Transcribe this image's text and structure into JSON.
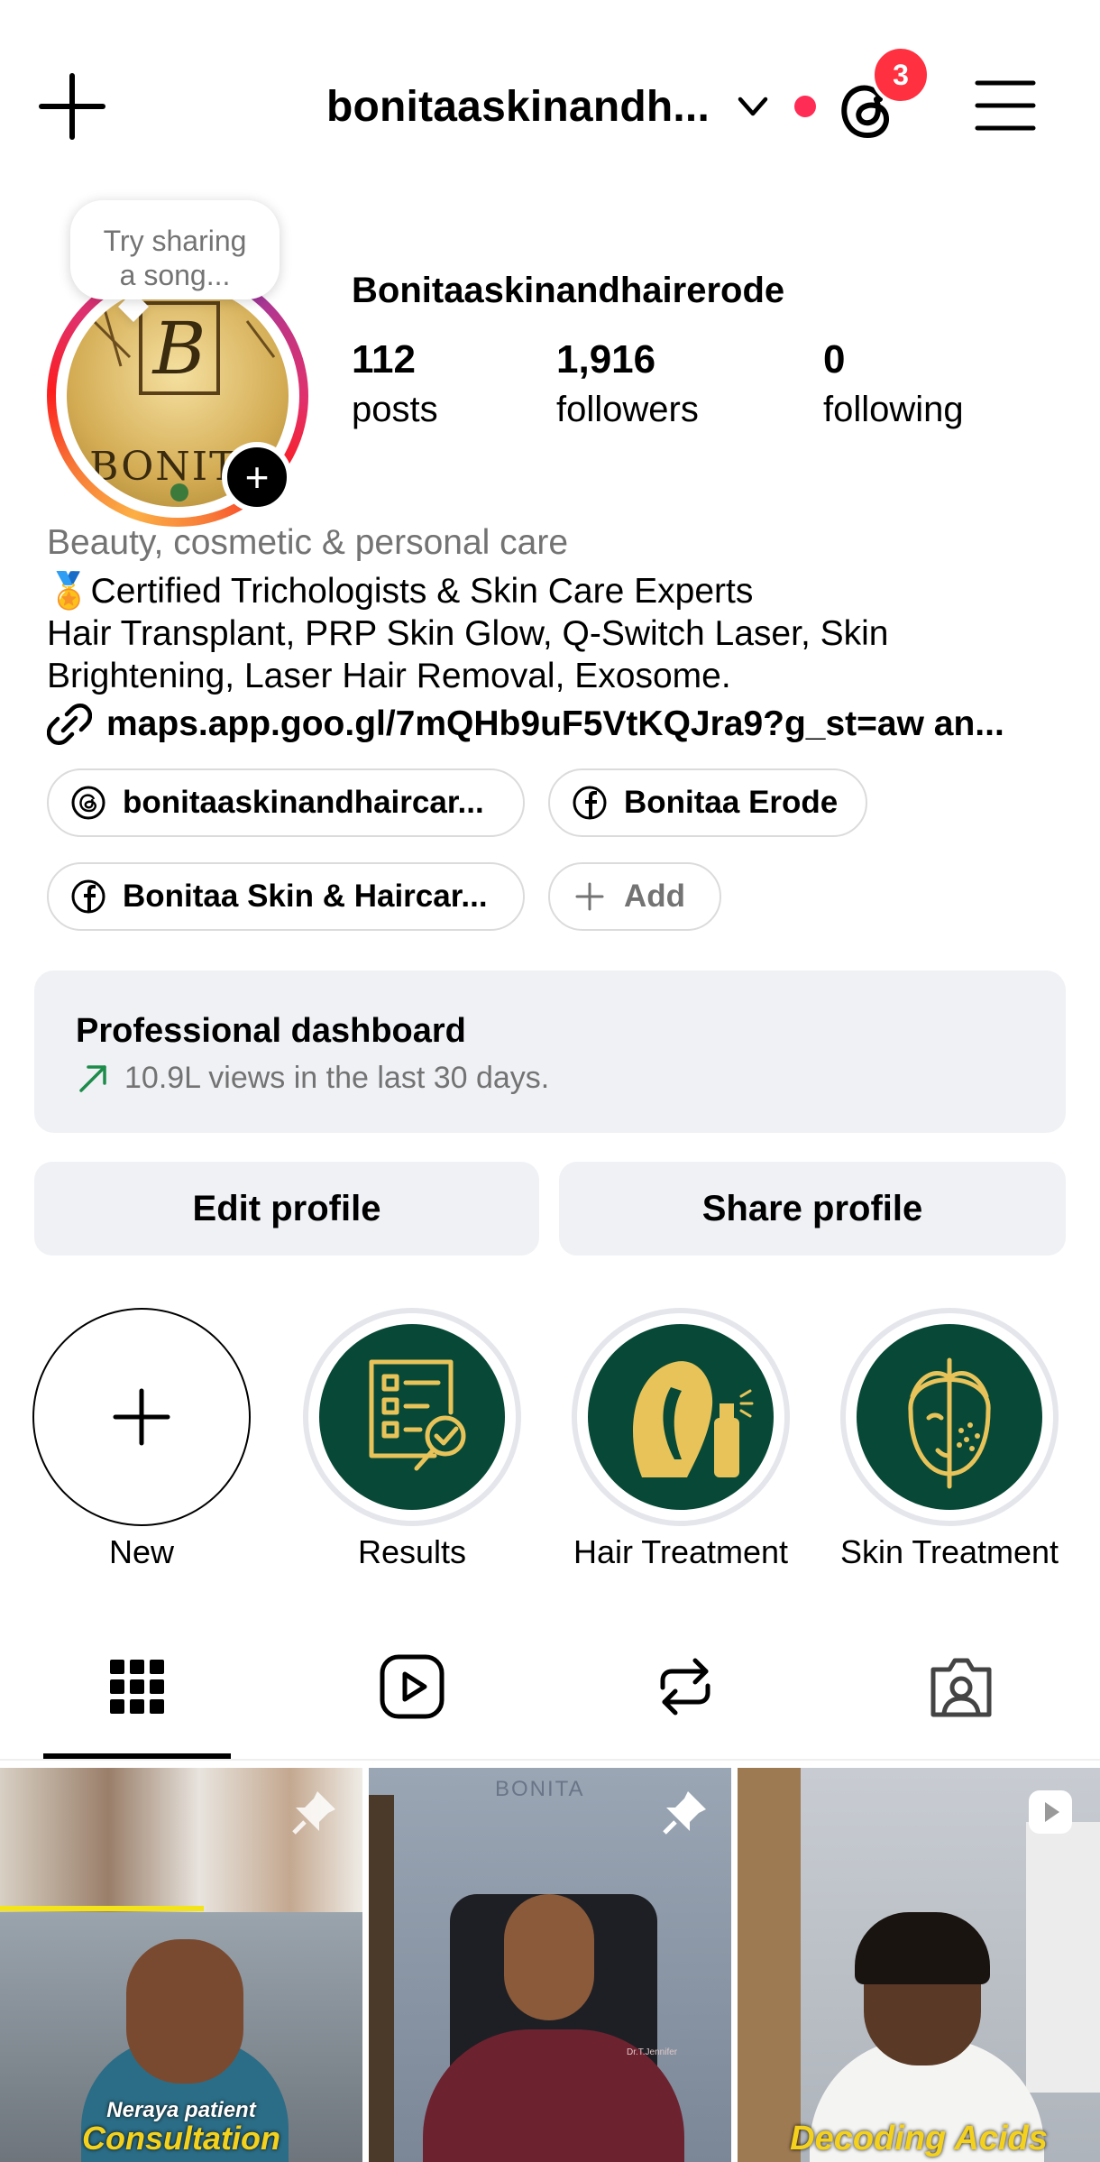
{
  "header": {
    "username": "bonitaaskinandh...",
    "notification_count": "3"
  },
  "profile": {
    "tooltip": "Try sharing a song...",
    "avatar_text": "BONITA",
    "display_name": "Bonitaaskinandhairerode",
    "stats": [
      {
        "value": "112",
        "label": "posts"
      },
      {
        "value": "1,916",
        "label": "followers"
      },
      {
        "value": "0",
        "label": "following"
      }
    ],
    "category": "Beauty, cosmetic & personal care",
    "bio_line1": "🏅Certified Trichologists & Skin Care Experts",
    "bio_line2": "Hair Transplant, PRP Skin Glow, Q-Switch Laser, Skin",
    "bio_line3": "Brightening, Laser Hair Removal, Exosome.",
    "link": "maps.app.goo.gl/7mQHb9uF5VtKQJra9?g_st=aw an..."
  },
  "chips": [
    {
      "label": "bonitaaskinandhaircar...",
      "icon": "threads-icon"
    },
    {
      "label": "Bonitaa Erode",
      "icon": "facebook-icon"
    },
    {
      "label": "Bonitaa Skin & Haircar...",
      "icon": "facebook-icon"
    },
    {
      "label": "Add",
      "icon": "plus-icon"
    }
  ],
  "dashboard": {
    "title": "Professional dashboard",
    "subtitle": "10.9L views in the last 30 days."
  },
  "buttons": {
    "edit": "Edit profile",
    "share": "Share profile"
  },
  "highlights": [
    {
      "label": "New"
    },
    {
      "label": "Results"
    },
    {
      "label": "Hair Treatment"
    },
    {
      "label": "Skin Treatment"
    }
  ],
  "posts": [
    {
      "caption_top": "Neraya patient",
      "caption_bottom": "Consultation"
    },
    {
      "watermark": "BONITA",
      "shirt_text": "Dr.T.Jennifer"
    },
    {
      "caption_bottom": "Decoding Acids"
    }
  ],
  "colors": {
    "accent_red": "#ff3040",
    "highlight_green": "#074936",
    "highlight_gold": "#e8c35a",
    "chip_border": "#dbdbdb",
    "card_bg": "#eff1f5"
  }
}
